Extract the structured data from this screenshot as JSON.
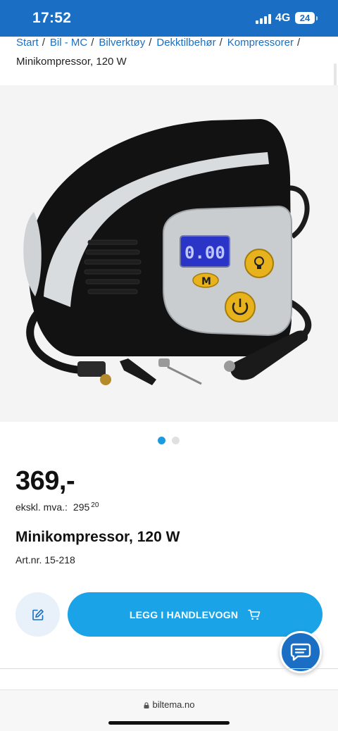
{
  "status_bar": {
    "time": "17:52",
    "network": "4G",
    "battery": "24"
  },
  "breadcrumb": {
    "items": [
      "Start",
      "Bil - MC",
      "Bilverktøy",
      "Dekktilbehør",
      "Kompressorer"
    ],
    "current": "Minikompressor, 120 W"
  },
  "product": {
    "device_display": "0.00",
    "device_mode_label": "M",
    "gallery_pages": 2,
    "gallery_active": 1,
    "price": "369,-",
    "excl_vat_label": "ekskl. mva.:",
    "excl_vat_integer": "295",
    "excl_vat_decimal": "20",
    "title": "Minikompressor, 120 W",
    "article_number": "Art.nr. 15-218"
  },
  "actions": {
    "note_icon": "edit-note-icon",
    "add_to_cart": "LEGG I HANDLEVOGN",
    "cart_icon": "cart-icon",
    "chat_icon": "chat-bubble-icon"
  },
  "browser": {
    "url": "biltema.no",
    "lock_icon": "lock-icon"
  },
  "colors": {
    "brand_blue": "#1a6fc4",
    "button_blue": "#1aa3e6",
    "link_blue": "#1a6fc4",
    "active_dot": "#1a9be0"
  }
}
